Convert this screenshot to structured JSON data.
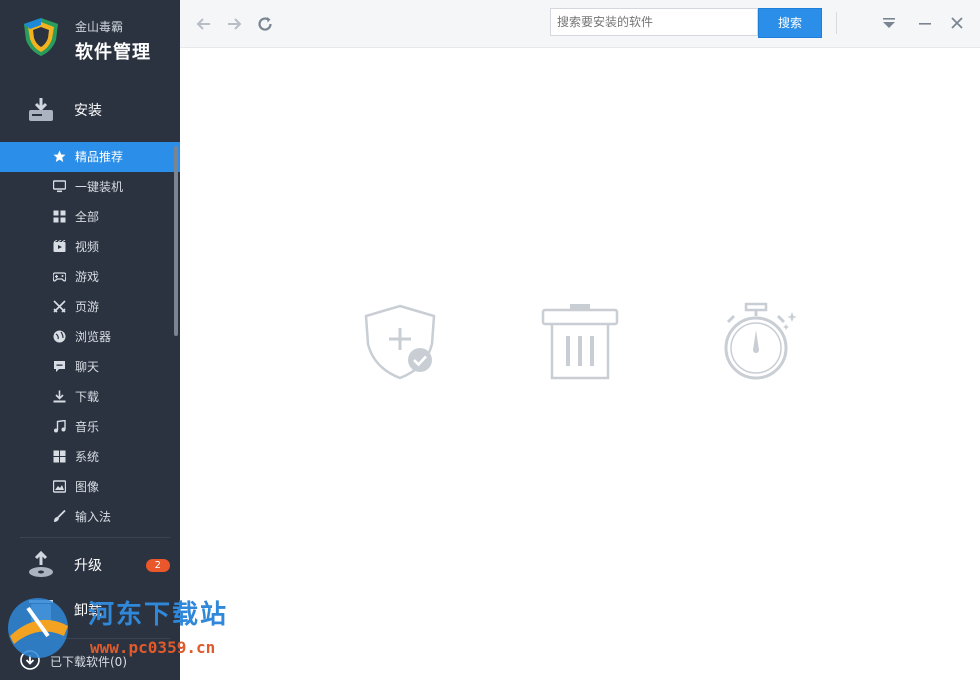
{
  "brand": {
    "line1": "金山毒霸",
    "line2": "软件管理"
  },
  "sections": {
    "install": {
      "label": "安装"
    },
    "upgrade": {
      "label": "升级",
      "badge": "2"
    },
    "uninstall": {
      "label": "卸载"
    }
  },
  "nav": [
    {
      "label": "精品推荐",
      "icon": "star-icon",
      "active": true
    },
    {
      "label": "一键装机",
      "icon": "monitor-icon"
    },
    {
      "label": "全部",
      "icon": "grid-icon"
    },
    {
      "label": "视频",
      "icon": "video-icon"
    },
    {
      "label": "游戏",
      "icon": "gamepad-icon"
    },
    {
      "label": "页游",
      "icon": "swords-icon"
    },
    {
      "label": "浏览器",
      "icon": "globe-icon"
    },
    {
      "label": "聊天",
      "icon": "chat-icon"
    },
    {
      "label": "下载",
      "icon": "download-icon"
    },
    {
      "label": "音乐",
      "icon": "music-icon"
    },
    {
      "label": "系统",
      "icon": "windows-icon"
    },
    {
      "label": "图像",
      "icon": "image-icon"
    },
    {
      "label": "输入法",
      "icon": "brush-icon"
    }
  ],
  "downloaded": {
    "label": "已下载软件(0)"
  },
  "search": {
    "placeholder": "搜索要安装的软件",
    "button": "搜索"
  },
  "watermark": {
    "text": "河东下载站",
    "url": "www.pc0359.cn"
  },
  "colors": {
    "sidebar": "#2b3340",
    "accent": "#2b8ee8",
    "badge": "#e9572b"
  }
}
